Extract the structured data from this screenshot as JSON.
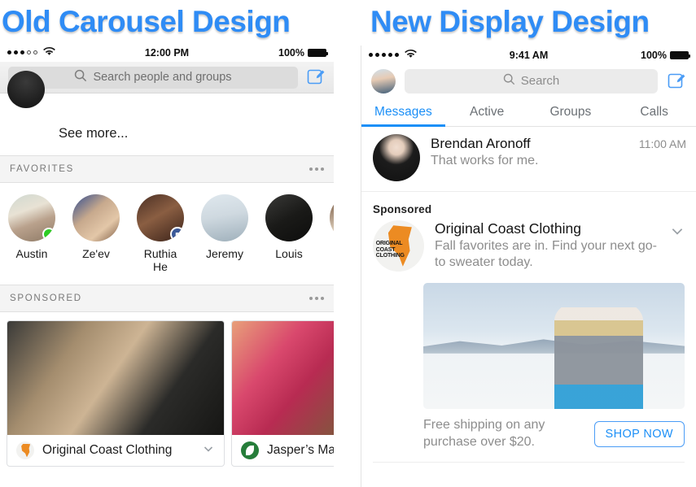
{
  "titles": {
    "left": "Old Carousel Design",
    "right": "New Display Design",
    "color": "#2f8cf5"
  },
  "left_panel": {
    "status_bar": {
      "signal": "●●●○○",
      "time": "12:00 PM",
      "battery_percent": "100%"
    },
    "search": {
      "placeholder": "Search people and groups",
      "icon": "search-icon"
    },
    "compose_icon": "compose-icon",
    "see_more": "See more...",
    "favorites": {
      "header": "FAVORITES",
      "people": [
        {
          "name": "Austin",
          "badge": "online"
        },
        {
          "name": "Ze'ev",
          "badge": "none"
        },
        {
          "name": "Ruthia He",
          "badge": "birthday"
        },
        {
          "name": "Jeremy",
          "badge": "none"
        },
        {
          "name": "Louis",
          "badge": "none"
        }
      ]
    },
    "sponsored": {
      "header": "SPONSORED",
      "cards": [
        {
          "advertiser": "Original Coast Clothing",
          "chevron": "chevron-down-icon"
        },
        {
          "advertiser": "Jasper’s Ma",
          "chevron": "chevron-down-icon"
        }
      ]
    }
  },
  "right_panel": {
    "status_bar": {
      "signal": "●●●●●",
      "time": "9:41 AM",
      "battery_percent": "100%"
    },
    "search": {
      "placeholder": "Search",
      "icon": "search-icon"
    },
    "compose_icon": "compose-icon",
    "tabs": [
      {
        "label": "Messages",
        "active": true
      },
      {
        "label": "Active",
        "active": false
      },
      {
        "label": "Groups",
        "active": false
      },
      {
        "label": "Calls",
        "active": false
      }
    ],
    "tab_accent": "#1b8ff7",
    "messages": [
      {
        "name": "Brendan Aronoff",
        "preview": "That works for me.",
        "time": "11:00 AM"
      }
    ],
    "sponsored": {
      "label": "Sponsored",
      "advertiser": "Original Coast Clothing",
      "body": "Fall favorites are in. Find your next go-to sweater today.",
      "chevron": "chevron-down-icon",
      "logo_text": "ORIGINAL COAST CLOTHING",
      "cta_text": "Free shipping on any purchase over $20.",
      "cta_button": "SHOP NOW"
    }
  }
}
